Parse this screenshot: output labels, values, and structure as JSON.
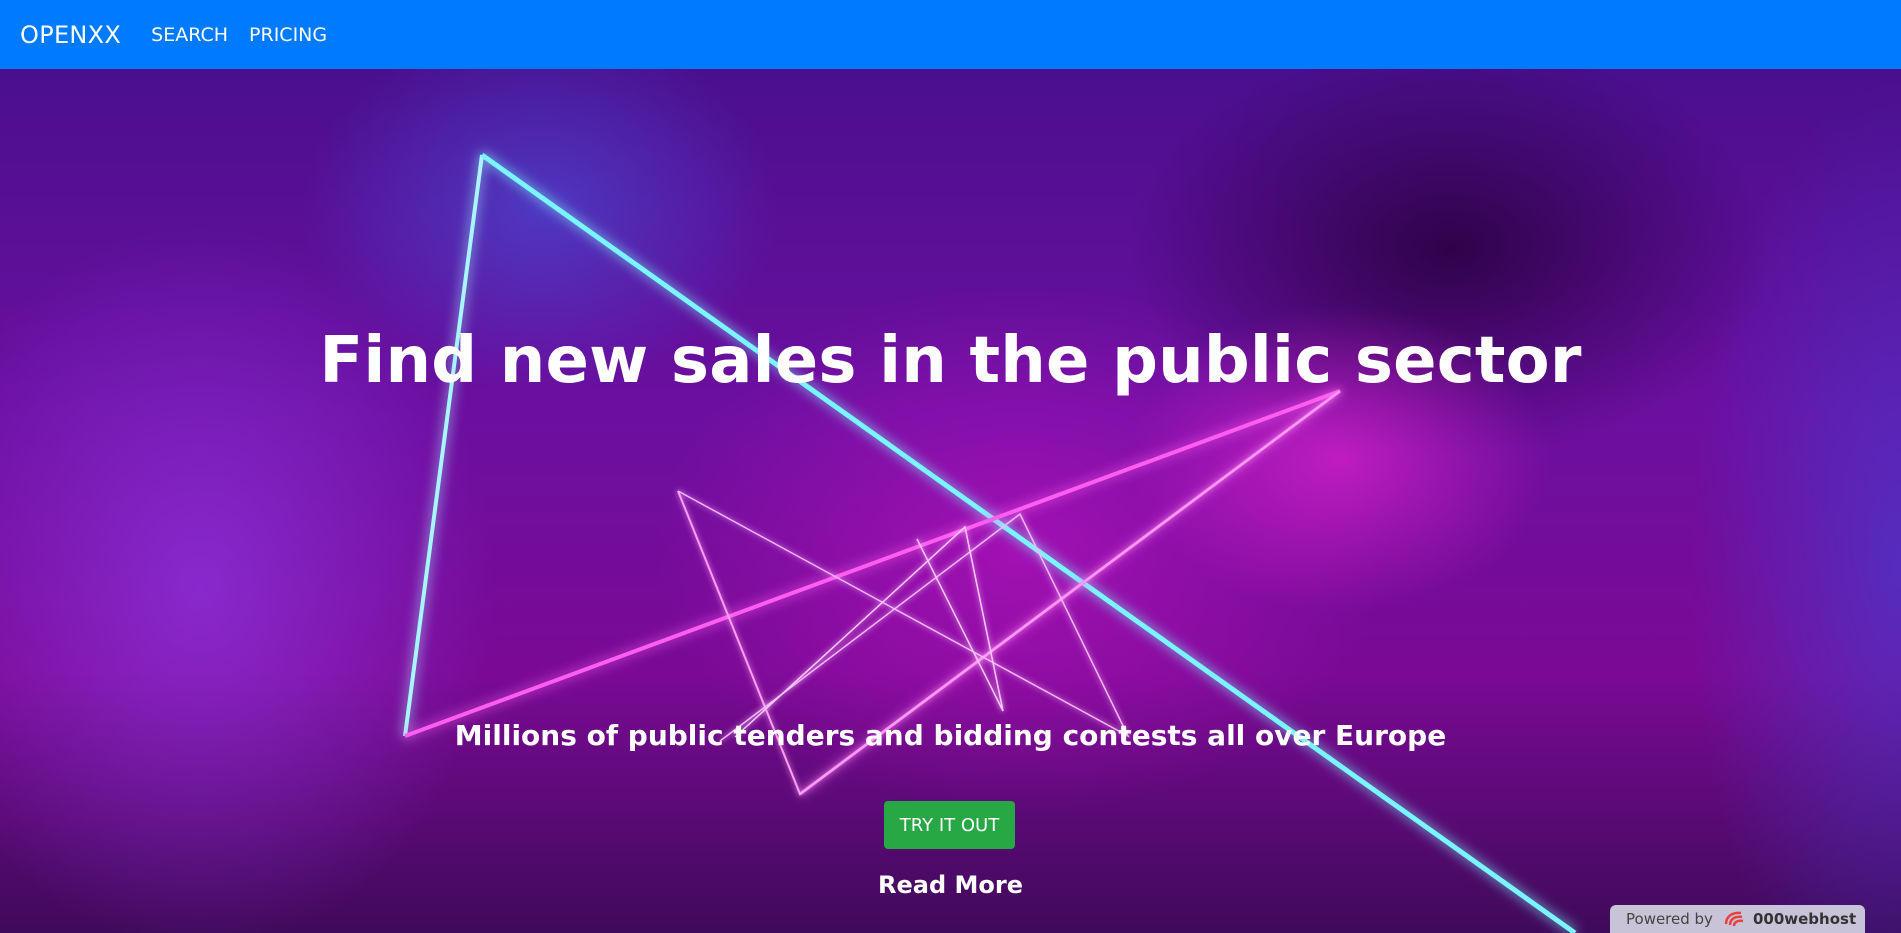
{
  "navbar": {
    "brand": "OPENXX",
    "links": [
      "SEARCH",
      "PRICING"
    ]
  },
  "hero": {
    "title": "Find new sales in the public sector",
    "subtitle": "Millions of public tenders and bidding contests all over Europe",
    "cta_label": "TRY IT OUT",
    "read_more": "Read More"
  },
  "footer_badge": {
    "powered_by": "Powered by",
    "host": "000webhost"
  },
  "colors": {
    "navbar": "#007bff",
    "cta": "#28a745",
    "neon_cyan": "#5ff0ff",
    "neon_pink": "#ff4cf0"
  },
  "icons": [
    "neon-triangle-beams",
    "000webhost-logo-icon"
  ]
}
